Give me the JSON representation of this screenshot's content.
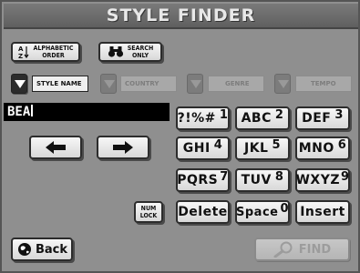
{
  "title": "STYLE FINDER",
  "toolbar": {
    "alpha_line1": "ALPHABETIC",
    "alpha_line2": "ORDER",
    "search_line1": "SEARCH",
    "search_line2": "ONLY"
  },
  "filters": {
    "style_name": "STYLE NAME",
    "country": "COUNTRY",
    "genre": "GENRE",
    "tempo": "TEMPO"
  },
  "entry_value": "BEA",
  "keypad": {
    "k1_text": "?!%#",
    "k1_num": "1",
    "k2_text": "ABC",
    "k2_num": "2",
    "k3_text": "DEF",
    "k3_num": "3",
    "k4_text": "GHI",
    "k4_num": "4",
    "k5_text": "JKL",
    "k5_num": "5",
    "k6_text": "MNO",
    "k6_num": "6",
    "k7_text": "PQRS",
    "k7_num": "7",
    "k8_text": "TUV",
    "k8_num": "8",
    "k9_text": "WXYZ",
    "k9_num": "9",
    "delete": "Delete",
    "space_text": "Space",
    "space_num": "0",
    "insert": "Insert"
  },
  "numlock_line1": "NUM",
  "numlock_line2": "LOCK",
  "back_label": "Back",
  "find_label": "FIND"
}
